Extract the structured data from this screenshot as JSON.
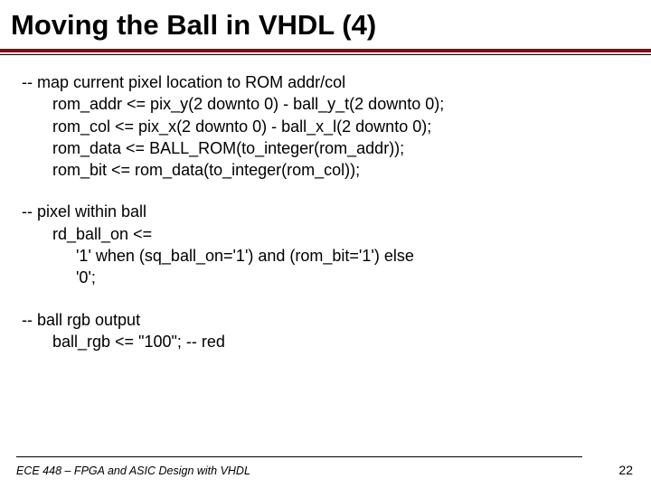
{
  "title": "Moving the Ball in VHDL (4)",
  "block1": {
    "comment": "-- map current pixel location to ROM addr/col",
    "l1": "rom_addr <= pix_y(2 downto 0) - ball_y_t(2 downto 0);",
    "l2": "rom_col   <= pix_x(2 downto 0) - ball_x_l(2 downto 0);",
    "l3": "rom_data <= BALL_ROM(to_integer(rom_addr));",
    "l4": "rom_bit    <= rom_data(to_integer(rom_col));"
  },
  "block2": {
    "comment": "-- pixel within ball",
    "l1": "rd_ball_on <=",
    "l2": "'1' when (sq_ball_on='1') and (rom_bit='1') else",
    "l3": "'0';"
  },
  "block3": {
    "comment": "-- ball rgb output",
    "l1": "ball_rgb <= \"100\";   -- red"
  },
  "footer": {
    "left": "ECE 448 – FPGA and ASIC Design with VHDL",
    "page": "22"
  }
}
